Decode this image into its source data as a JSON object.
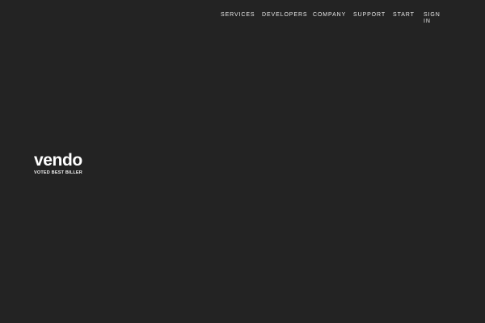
{
  "nav": {
    "items": [
      {
        "label": "SERVICES"
      },
      {
        "label": "DEVELOPERS"
      },
      {
        "label": "COMPANY"
      },
      {
        "label": "SUPPORT"
      },
      {
        "label": "START"
      },
      {
        "label": "SIGN IN"
      }
    ]
  },
  "brand": {
    "logo_text": "vendo",
    "tagline": "VOTED BEST BILLER"
  },
  "colors": {
    "background": "#232323",
    "text": "#ffffff"
  }
}
